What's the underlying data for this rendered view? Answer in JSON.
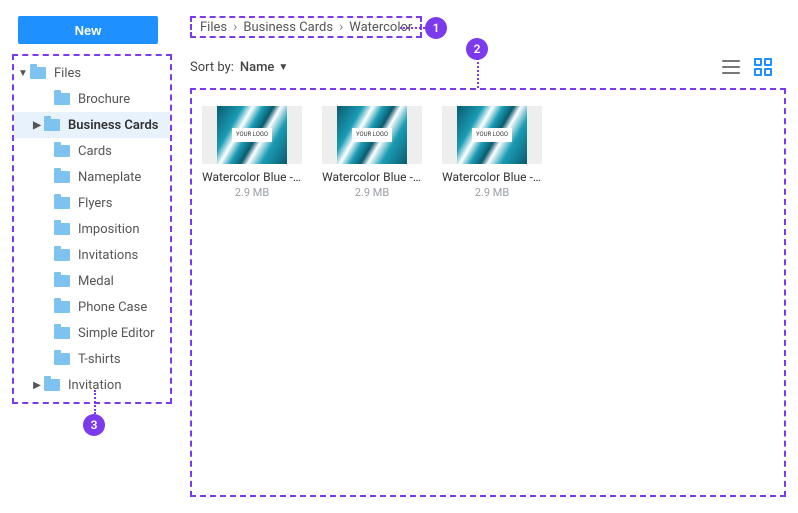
{
  "sidebar": {
    "new_label": "New",
    "root": {
      "label": "Files"
    },
    "items": [
      {
        "label": "Brochure"
      },
      {
        "label": "Business Cards"
      },
      {
        "label": "Cards"
      },
      {
        "label": "Nameplate"
      },
      {
        "label": "Flyers"
      },
      {
        "label": "Imposition"
      },
      {
        "label": "Invitations"
      },
      {
        "label": "Medal"
      },
      {
        "label": "Phone Case"
      },
      {
        "label": "Simple Editor"
      },
      {
        "label": "T-shirts"
      },
      {
        "label": "Invitation"
      }
    ]
  },
  "breadcrumb": {
    "items": [
      "Files",
      "Business Cards",
      "Watercolor"
    ]
  },
  "sort": {
    "label": "Sort by:",
    "value": "Name"
  },
  "thumb_badge": "YOUR LOGO",
  "files": [
    {
      "name": "Watercolor Blue - ...",
      "size": "2.9 MB"
    },
    {
      "name": "Watercolor Blue - ...",
      "size": "2.9 MB"
    },
    {
      "name": "Watercolor Blue - ...",
      "size": "2.9 MB"
    }
  ],
  "markers": {
    "1": "1",
    "2": "2",
    "3": "3"
  }
}
